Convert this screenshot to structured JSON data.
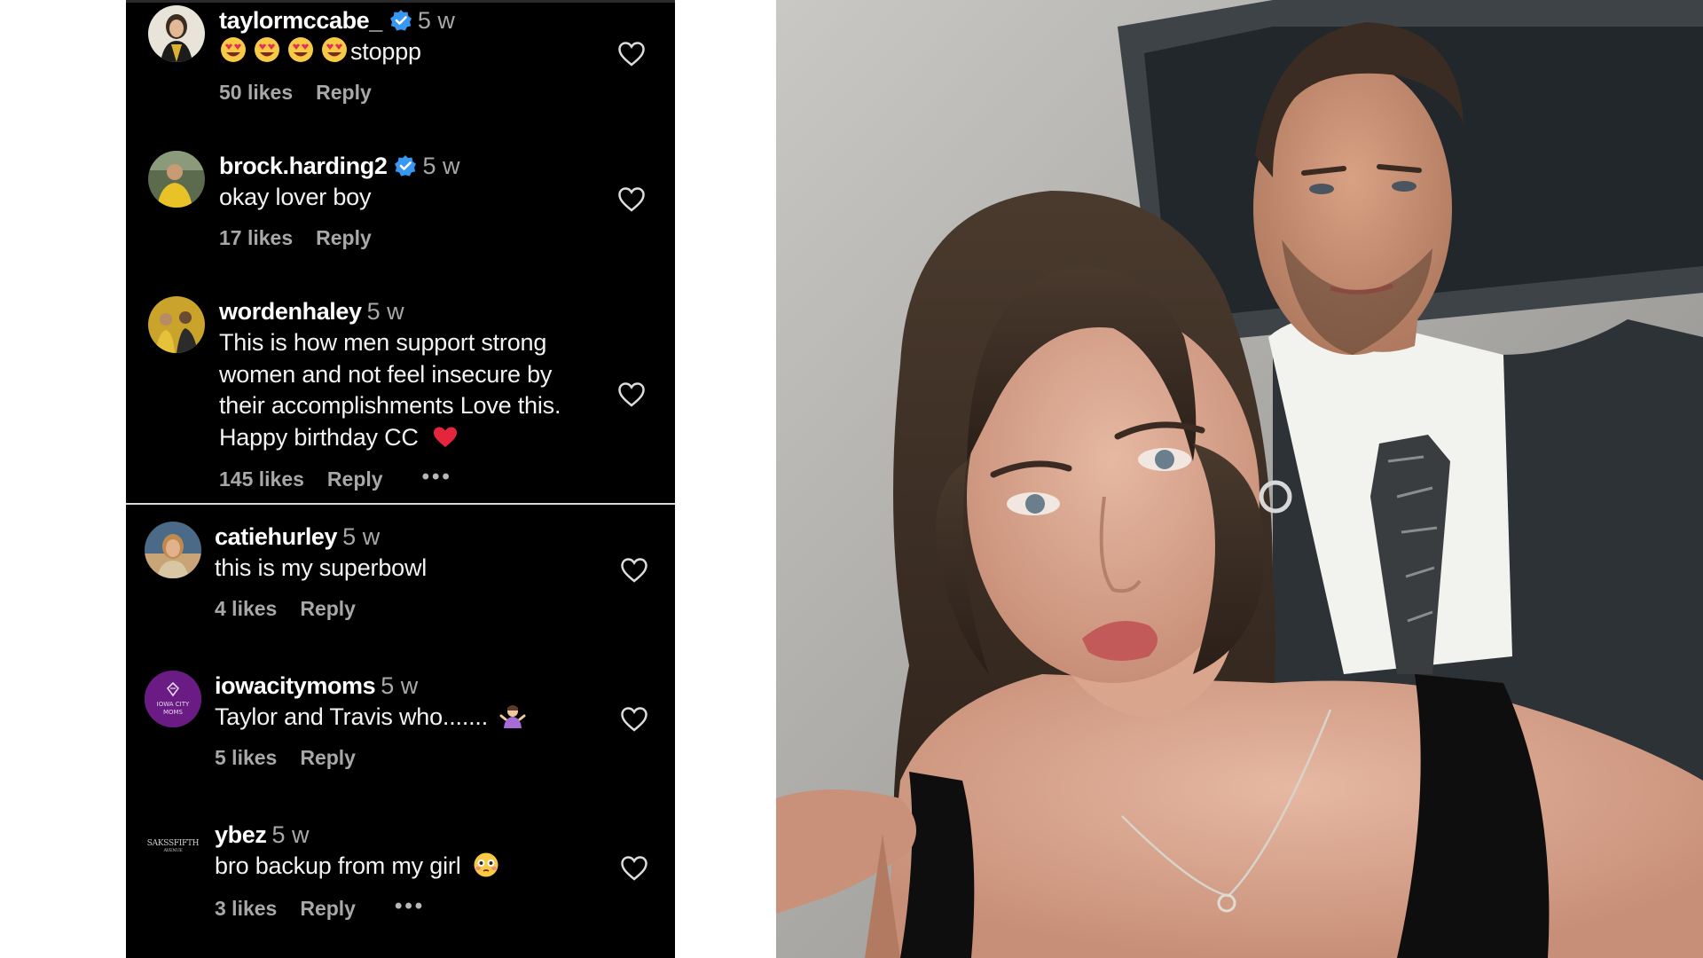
{
  "comments": [
    {
      "username": "taylormccabe_",
      "verified": true,
      "time": "5 w",
      "text": "stoppp",
      "emoji": [
        "heart-eyes-emoji",
        "heart-eyes-emoji",
        "heart-eyes-emoji",
        "heart-eyes-emoji"
      ],
      "likes": "50 likes",
      "reply": "Reply",
      "avatar": "avatar-taylormccabe"
    },
    {
      "username": "brock.harding2",
      "verified": true,
      "time": "5 w",
      "text": "okay lover boy",
      "likes": "17 likes",
      "reply": "Reply",
      "avatar": "avatar-brock"
    },
    {
      "username": "wordenhaley",
      "verified": false,
      "time": "5 w",
      "text_lines": [
        "This is how men support strong",
        "women and not feel insecure by",
        "their accomplishments Love this.",
        "Happy birthday CC"
      ],
      "emoji": "red-heart-emoji",
      "likes": "145 likes",
      "reply": "Reply",
      "more": "•••"
    },
    {
      "username": "catiehurley",
      "verified": false,
      "time": "5 w",
      "text": "this is my superbowl",
      "likes": "4 likes",
      "reply": "Reply"
    },
    {
      "username": "iowacitymoms",
      "verified": false,
      "time": "5 w",
      "text": "Taylor and Travis who.......",
      "emoji": "person-shrugging-emoji",
      "likes": "5 likes",
      "reply": "Reply",
      "avatar_text": [
        "IOWA CITY",
        "MOMS"
      ]
    },
    {
      "username": "ybez",
      "verified": false,
      "time": "5 w",
      "text": "bro backup from my girl",
      "emoji": "flushed-face-emoji",
      "likes": "3 likes",
      "reply": "Reply",
      "more": "•••",
      "avatar_text": [
        "SAKSSFIFTH",
        "AVENUE"
      ]
    }
  ],
  "colors": {
    "panel_bg": "#000000",
    "text": "#ffffff",
    "muted": "#a8a8a8",
    "verified": "#3897f0",
    "divider": "#d8d8d8",
    "iowacitymoms_avatar": "#6b1b84"
  },
  "photo": {
    "description_icon": "couple-selfie-photo"
  }
}
